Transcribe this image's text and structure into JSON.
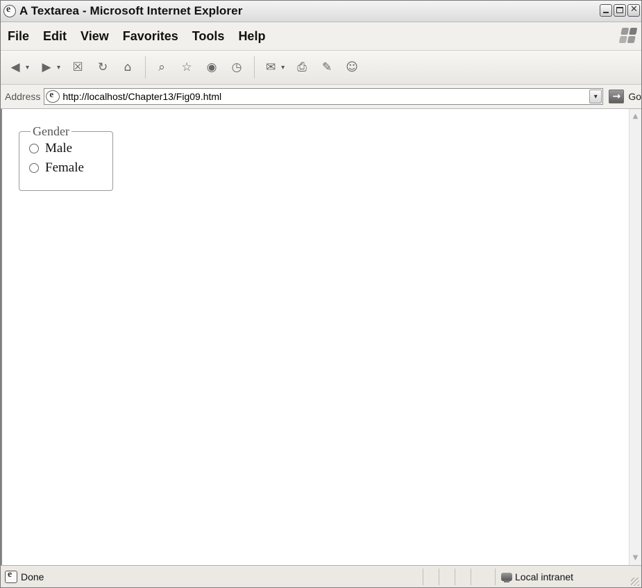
{
  "window": {
    "title": "A Textarea - Microsoft Internet Explorer",
    "controls": [
      "minimize-icon",
      "maximize-icon",
      "close-icon"
    ]
  },
  "menu": [
    "File",
    "Edit",
    "View",
    "Favorites",
    "Tools",
    "Help"
  ],
  "toolbar": {
    "icons": [
      "back-icon",
      "forward-icon",
      "stop-icon",
      "refresh-icon",
      "home-icon",
      "search-icon",
      "favorites-icon",
      "media-icon",
      "history-icon",
      "mail-icon",
      "print-icon",
      "edit-icon",
      "messenger-icon"
    ]
  },
  "address": {
    "label": "Address",
    "url": "http://localhost/Chapter13/Fig09.html",
    "go_label": "Go"
  },
  "form": {
    "legend": "Gender",
    "options": [
      {
        "label": "Male",
        "checked": false
      },
      {
        "label": "Female",
        "checked": false
      }
    ]
  },
  "status": {
    "text": "Done",
    "zone": "Local intranet"
  }
}
